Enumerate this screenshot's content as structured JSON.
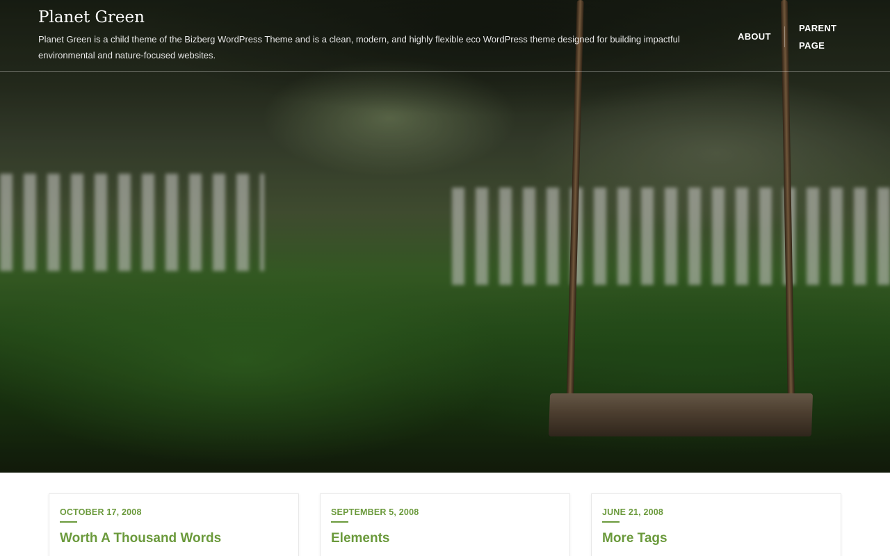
{
  "header": {
    "site_title": "Planet Green",
    "site_description": "Planet Green is a child theme of the Bizberg WordPress Theme and is a clean, modern, and highly flexible eco WordPress theme designed for building impactful environmental and nature-focused websites."
  },
  "nav": {
    "items": [
      {
        "label": "ABOUT"
      },
      {
        "label": "PARENT PAGE"
      }
    ]
  },
  "posts": [
    {
      "date": "OCTOBER 17, 2008",
      "title": "Worth A Thousand Words"
    },
    {
      "date": "SEPTEMBER 5, 2008",
      "title": "Elements"
    },
    {
      "date": "JUNE 21, 2008",
      "title": "More Tags"
    }
  ],
  "colors": {
    "accent": "#6b9a3c",
    "header_text": "#ffffff"
  }
}
